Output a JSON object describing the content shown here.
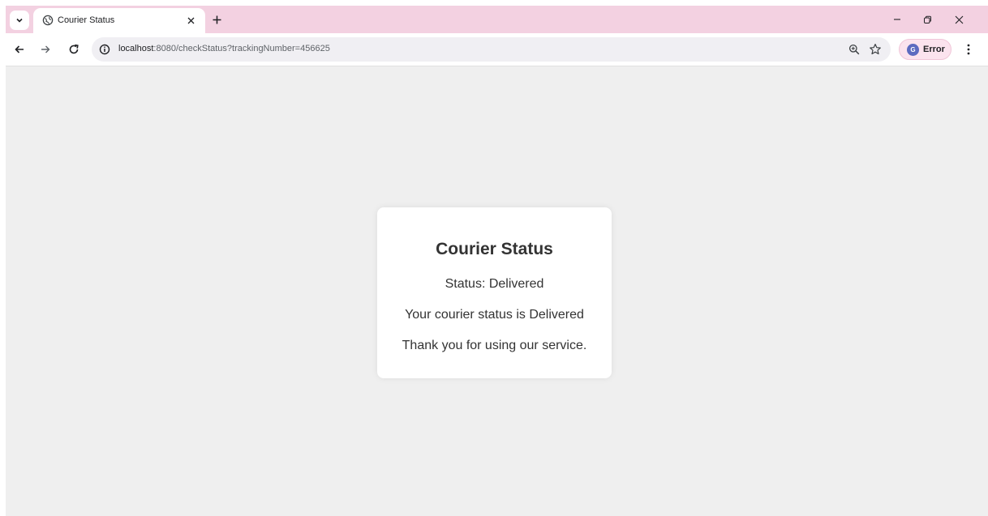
{
  "browser": {
    "tab": {
      "title": "Courier Status"
    },
    "omnibox": {
      "url_host": "localhost",
      "url_rest": ":8080/checkStatus?trackingNumber=456625"
    },
    "profile": {
      "initial": "G",
      "label": "Error"
    }
  },
  "icons": {
    "tab_search": "chevron-down-icon",
    "favicon": "globe-icon",
    "tab_close": "close-icon",
    "new_tab": "plus-icon",
    "back": "arrow-left-icon",
    "forward": "arrow-right-icon",
    "reload": "reload-icon",
    "site_info": "info-icon",
    "zoom": "zoom-icon",
    "bookmark": "star-icon",
    "menu": "kebab-menu-icon"
  },
  "colors": {
    "tabstrip": "#f3d1e1",
    "page_bg": "#efefef",
    "card_bg": "#ffffff",
    "avatar": "#5c6bc0"
  },
  "page": {
    "title": "Courier Status",
    "status_line": "Status: Delivered",
    "message": "Your courier status is Delivered",
    "thanks": "Thank you for using our service."
  }
}
